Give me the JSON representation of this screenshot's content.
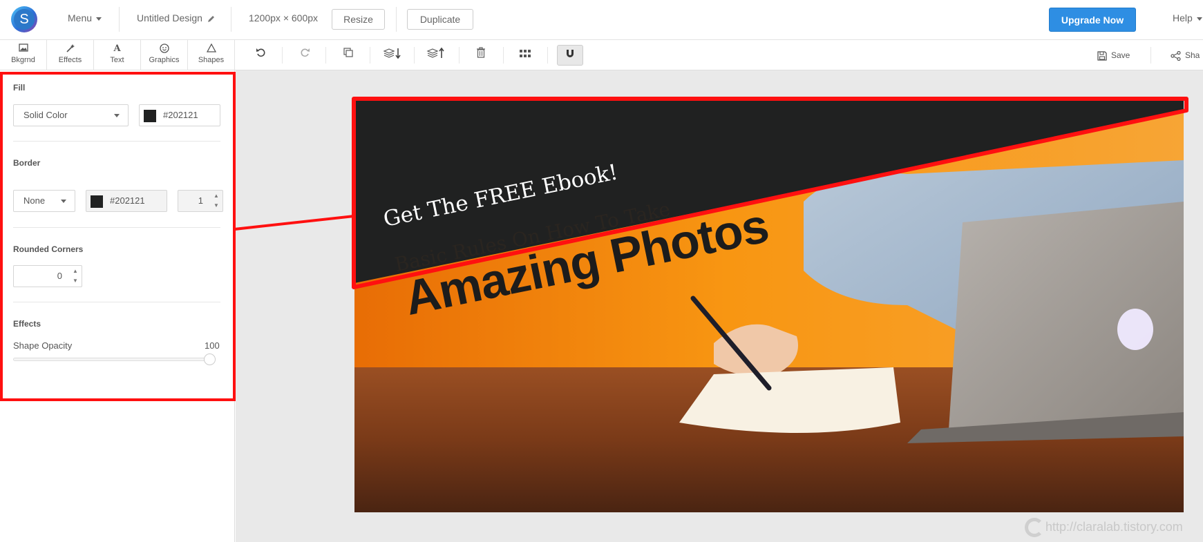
{
  "topbar": {
    "logo_letter": "S",
    "menu_label": "Menu",
    "design_title": "Untitled Design",
    "dimensions": "1200px × 600px",
    "resize_label": "Resize",
    "duplicate_label": "Duplicate",
    "upgrade_label": "Upgrade Now",
    "help_label": "Help"
  },
  "left_tools": [
    {
      "label": "Bkgrnd",
      "icon": "image-icon"
    },
    {
      "label": "Effects",
      "icon": "magic-wand-icon"
    },
    {
      "label": "Text",
      "icon": "text-icon"
    },
    {
      "label": "Graphics",
      "icon": "smiley-icon"
    },
    {
      "label": "Shapes",
      "icon": "triangle-icon"
    }
  ],
  "toolbar": {
    "save_label": "Save",
    "share_label": "Sha",
    "icons": [
      "undo-icon",
      "redo-icon",
      "copy-icon",
      "send-backward-icon",
      "bring-forward-icon",
      "delete-icon",
      "grid-icon",
      "magnet-icon",
      "save-icon",
      "share-icon"
    ]
  },
  "panel": {
    "fill": {
      "title": "Fill",
      "type": "Solid Color",
      "color": "#202121"
    },
    "border": {
      "title": "Border",
      "style": "None",
      "color": "#202121",
      "width": "1"
    },
    "rounded": {
      "title": "Rounded Corners",
      "value": "0"
    },
    "effects": {
      "title": "Effects",
      "opacity_label": "Shape Opacity",
      "opacity_value": "100",
      "opacity_fraction": 1.0
    }
  },
  "design": {
    "headline_free": "Get The FREE Ebook!",
    "headline_rules": "Basic Rules On How To Take",
    "headline_photos": "Amazing Photos",
    "shape_color": "#202121",
    "accent_color": "#f48a0c",
    "highlight_color": "#ff1010"
  },
  "watermark": "http://claralab.tistory.com"
}
